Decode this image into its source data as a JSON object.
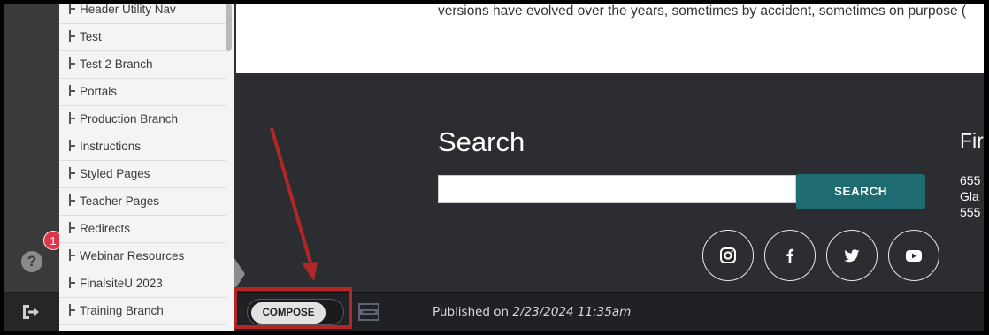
{
  "sidebar": {
    "help_badge": "1",
    "help_icon": "question-circle-icon",
    "logout_icon": "logout-icon"
  },
  "tree": {
    "items": [
      {
        "label": "Header Utility Nav"
      },
      {
        "label": "Test"
      },
      {
        "label": "Test 2 Branch"
      },
      {
        "label": "Portals"
      },
      {
        "label": "Production Branch"
      },
      {
        "label": "Instructions"
      },
      {
        "label": "Styled Pages"
      },
      {
        "label": "Teacher Pages"
      },
      {
        "label": "Redirects"
      },
      {
        "label": "Webinar Resources"
      },
      {
        "label": "FinalsiteU 2023"
      },
      {
        "label": "Training Branch"
      }
    ]
  },
  "article": {
    "text": "versions have evolved over the years, sometimes by accident, sometimes on purpose ("
  },
  "footer": {
    "search_title": "Search",
    "search_placeholder": "",
    "search_button": "SEARCH",
    "find_title": "Fir",
    "address_lines": [
      "655",
      "Gla",
      "555"
    ],
    "social": [
      "instagram-icon",
      "facebook-icon",
      "twitter-icon",
      "youtube-icon"
    ]
  },
  "statusbar": {
    "compose_label": "COMPOSE",
    "published_prefix": "Published on ",
    "published_date": "2/23/2024 11:35am"
  },
  "colors": {
    "accent": "#1e6c72",
    "badge": "#e0344a",
    "annotation": "#b32626",
    "footer_bg": "#2c2d33"
  }
}
